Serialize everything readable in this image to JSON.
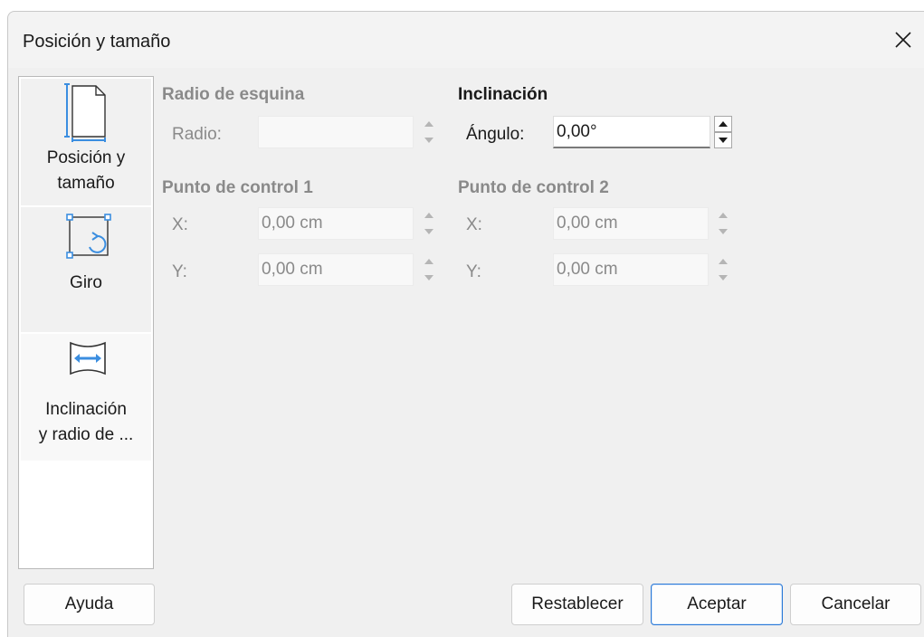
{
  "window": {
    "title": "Posición y tamaño"
  },
  "sidebar": {
    "items": [
      {
        "label_line1": "Posición y",
        "label_line2": "tamaño",
        "icon": "page-icon"
      },
      {
        "label_line1": "Giro",
        "icon": "rotate-icon"
      },
      {
        "label_line1": "Inclinación",
        "label_line2": "y radio de ...",
        "icon": "slant-icon",
        "selected": true
      }
    ]
  },
  "corner_radius": {
    "title": "Radio de esquina",
    "radius_label": "Radio:",
    "radius_value": ""
  },
  "slant": {
    "title": "Inclinación",
    "angle_label": "Ángulo:",
    "angle_value": "0,00°"
  },
  "control_point_1": {
    "title": "Punto de control 1",
    "x_label": "X:",
    "x_value": "0,00 cm",
    "y_label": "Y:",
    "y_value": "0,00 cm"
  },
  "control_point_2": {
    "title": "Punto de control 2",
    "x_label": "X:",
    "x_value": "0,00 cm",
    "y_label": "Y:",
    "y_value": "0,00 cm"
  },
  "buttons": {
    "help": "Ayuda",
    "reset": "Restablecer",
    "ok": "Aceptar",
    "cancel": "Cancelar"
  },
  "colors": {
    "accent": "#2b79d7",
    "icon_blue": "#3b8ee0",
    "disabled_text": "#8a8a8a"
  }
}
